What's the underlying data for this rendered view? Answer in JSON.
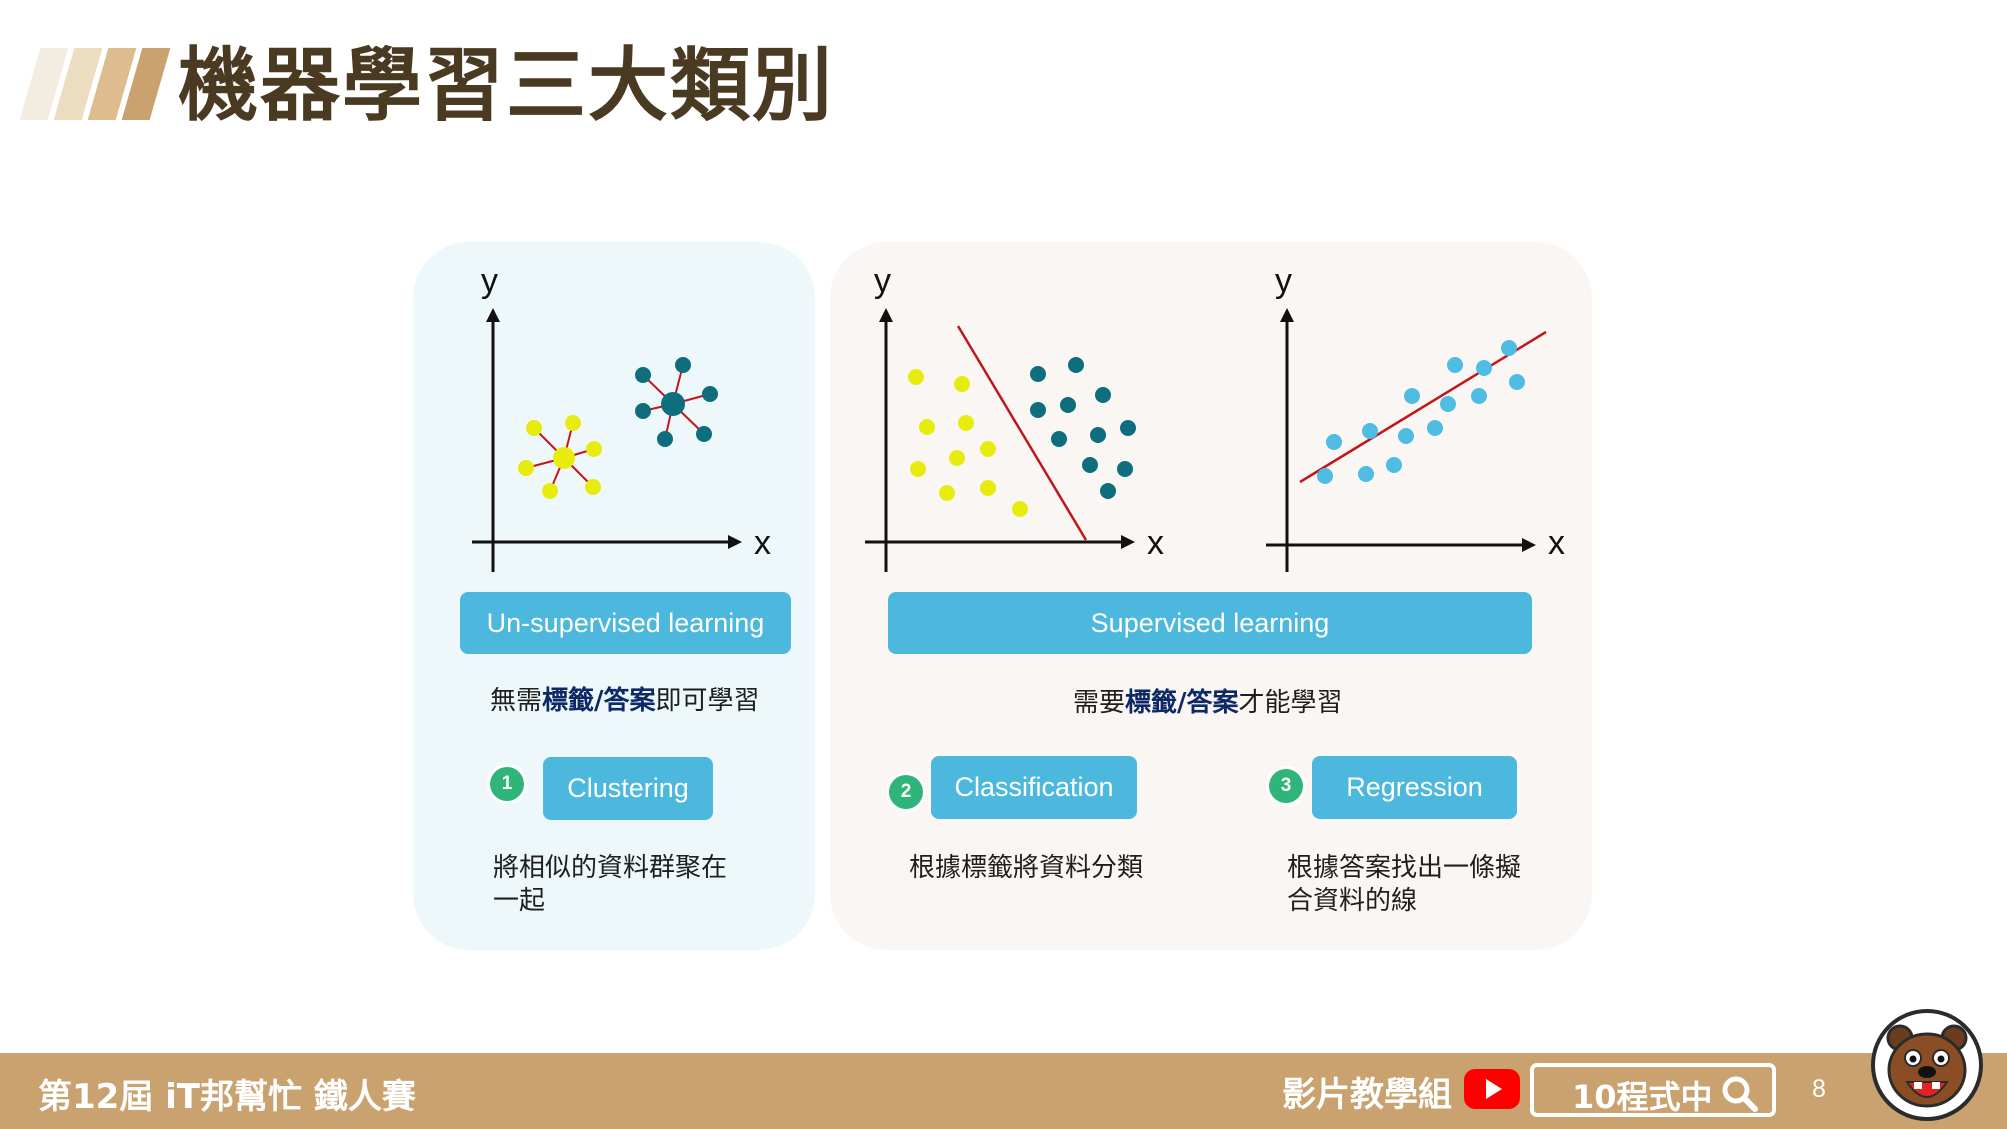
{
  "title": "機器學習三大類別",
  "colors": {
    "accent_blue": "#4db8de",
    "title_brown": "#4a3a22",
    "footer_tan": "#c9a26f",
    "badge_green": "#2fb47a",
    "yellow_points": "#e8ec0e",
    "teal_points": "#0e6e7e",
    "cyan_points": "#4fbde3",
    "divider_red": "#c0161c"
  },
  "unsupervised": {
    "label": "Un-supervised learning",
    "desc_prefix": "無需",
    "desc_bold": "標籤/答案",
    "desc_suffix": "即可學習",
    "method_number": "1",
    "method": "Clustering",
    "note_line1": "將相似的資料群聚在",
    "note_line2": "一起"
  },
  "supervised": {
    "label": "Supervised learning",
    "desc_prefix": "需要",
    "desc_bold": "標籤/答案",
    "desc_suffix": "才能學習",
    "classification": {
      "number": "2",
      "method": "Classification",
      "note": "根據標籤將資料分類"
    },
    "regression": {
      "number": "3",
      "method": "Regression",
      "note_line1": "根據答案找出一條擬",
      "note_line2": "合資料的線"
    }
  },
  "axes": {
    "x": "x",
    "y": "y"
  },
  "footer": {
    "event": "第12屆 iT邦幫忙 鐵人賽",
    "group": "影片教學組",
    "search_text": "10程式中",
    "page": "8",
    "icons": [
      "youtube-icon",
      "search-icon",
      "bear-mascot-icon"
    ]
  }
}
